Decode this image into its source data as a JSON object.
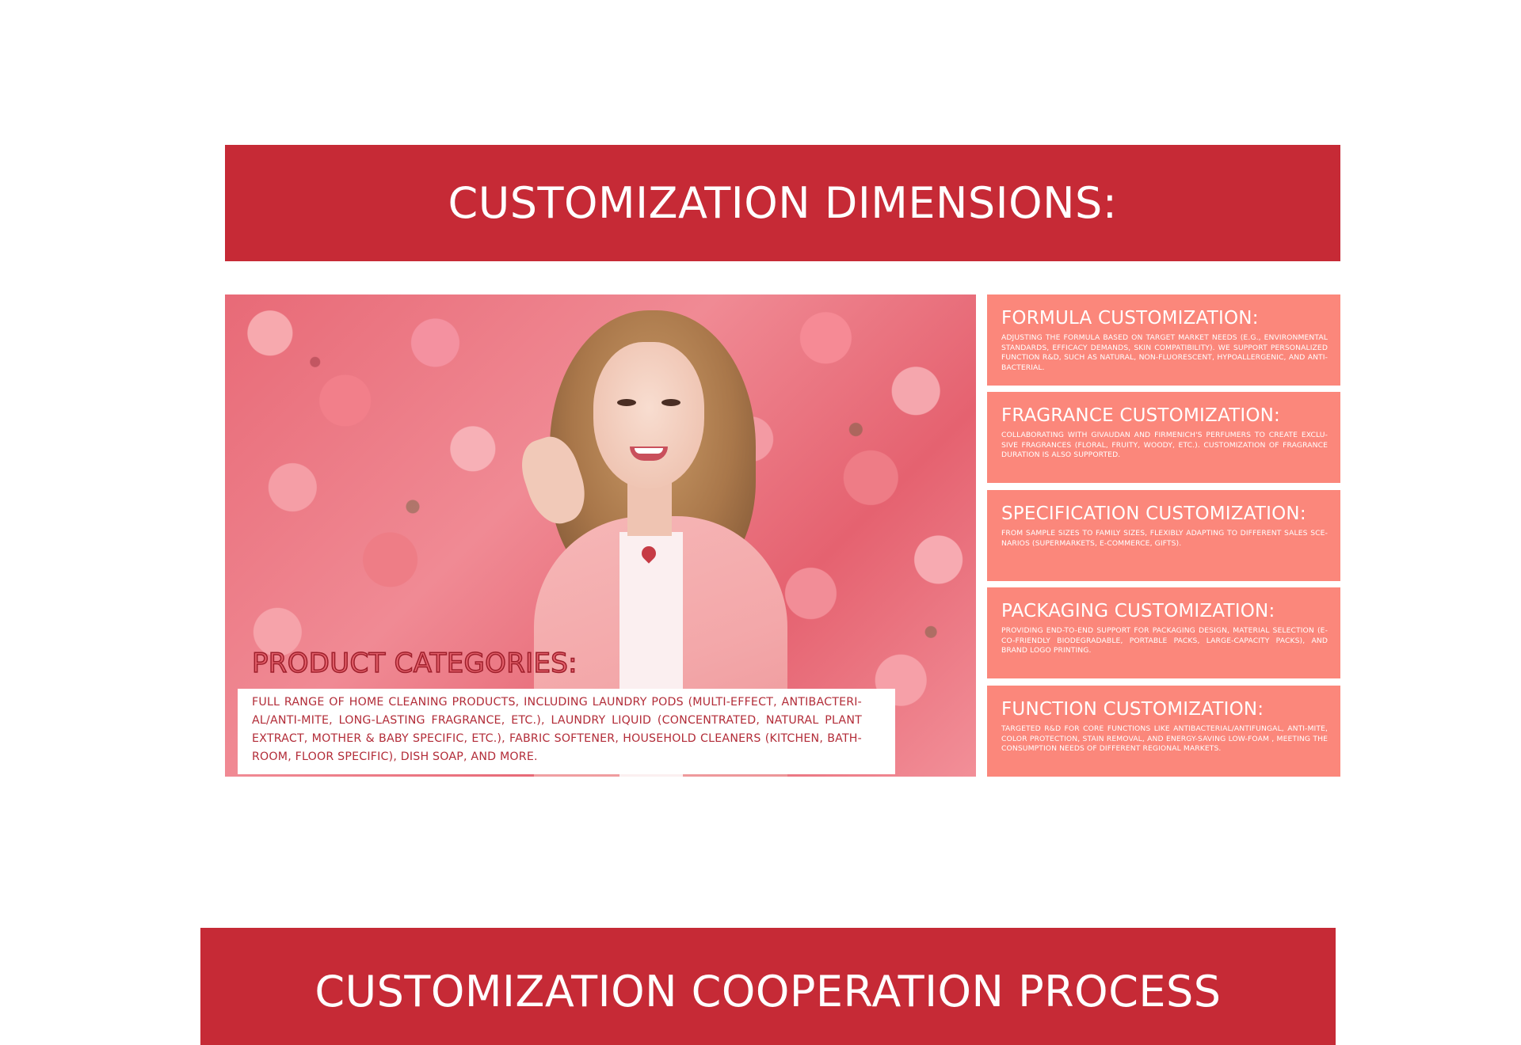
{
  "header": {
    "title": "CUSTOMIZATION DIMENSIONS:"
  },
  "photo": {
    "alt": "woman surrounded by pink roses"
  },
  "product_categories": {
    "title": "PRODUCT CATEGORIES:",
    "text": "FULL RANGE OF HOME CLEANING PRODUCTS, INCLUDING LAUNDRY PODS (MULTI-EFFECT, ANTIBACTERI-AL/ANTI-MITE, LONG-LASTING FRAGRANCE, ETC.), LAUNDRY LIQUID (CONCENTRATED, NATURAL PLANT EXTRACT, MOTHER & BABY SPECIFIC, ETC.), FABRIC SOFTENER, HOUSEHOLD CLEANERS (KITCHEN, BATH-ROOM, FLOOR SPECIFIC), DISH SOAP, AND MORE."
  },
  "cards": [
    {
      "title": "FORMULA CUSTOMIZATION:",
      "text": "ADJUSTING THE FORMULA BASED ON TARGET MARKET NEEDS (E.G., ENVIRONMENTAL STANDARDS, EFFICACY DEMANDS, SKIN COMPATIBILITY). WE SUPPORT PERSONALIZED FUNCTION R&D, SUCH AS NATURAL, NON-FLUORESCENT, HYPOALLERGENIC, AND ANTI-BACTERIAL."
    },
    {
      "title": "FRAGRANCE CUSTOMIZATION:",
      "text": "COLLABORATING WITH GIVAUDAN AND FIRMENICH'S PERFUMERS TO CREATE EXCLU-SIVE FRAGRANCES (FLORAL, FRUITY, WOODY, ETC.). CUSTOMIZATION OF FRAGRANCE DURATION IS ALSO SUPPORTED."
    },
    {
      "title": "SPECIFICATION CUSTOMIZATION:",
      "text": "FROM SAMPLE SIZES TO FAMILY SIZES, FLEXIBLY ADAPTING TO DIFFERENT SALES SCE-NARIOS (SUPERMARKETS, E-COMMERCE, GIFTS)."
    },
    {
      "title": "PACKAGING CUSTOMIZATION:",
      "text": " PROVIDING END-TO-END SUPPORT FOR PACKAGING DESIGN, MATERIAL SELECTION (E-CO-FRIENDLY BIODEGRADABLE, PORTABLE PACKS, LARGE-CAPACITY PACKS), AND BRAND LOGO PRINTING."
    },
    {
      "title": "FUNCTION CUSTOMIZATION:",
      "text": "TARGETED R&D FOR CORE FUNCTIONS LIKE ANTIBACTERIAL/ANTIFUNGAL, ANTI-MITE, COLOR PROTECTION, STAIN REMOVAL, AND ENERGY-SAVING LOW-FOAM , MEETING THE CONSUMPTION NEEDS OF DIFFERENT REGIONAL MARKETS."
    }
  ],
  "footer": {
    "title": "CUSTOMIZATION COOPERATION PROCESS"
  },
  "colors": {
    "banner": "#c62a36",
    "card": "#fb877b",
    "category_text": "#b22c38"
  }
}
